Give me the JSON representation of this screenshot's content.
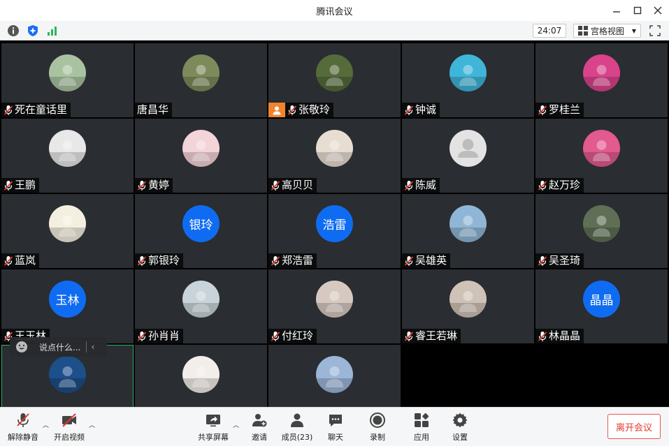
{
  "window": {
    "title": "腾讯会议"
  },
  "infobar": {
    "timer": "24:07",
    "view_label": "宫格视图"
  },
  "participants": [
    {
      "name": "死在童话里",
      "muted": true,
      "avatar": "photo",
      "color": "#a9c3a0"
    },
    {
      "name": "唐昌华",
      "muted": false,
      "avatar": "photo",
      "color": "#7d8a5a"
    },
    {
      "name": "张敬玲",
      "muted": true,
      "avatar": "photo",
      "color": "#556b3a",
      "host": true
    },
    {
      "name": "钟诚",
      "muted": true,
      "avatar": "photo",
      "color": "#3fb5d9"
    },
    {
      "name": "罗桂兰",
      "muted": true,
      "avatar": "photo",
      "color": "#d9438a"
    },
    {
      "name": "王鹏",
      "muted": true,
      "avatar": "photo",
      "color": "#e8e8e8"
    },
    {
      "name": "黄婷",
      "muted": true,
      "avatar": "photo",
      "color": "#f3d4d8"
    },
    {
      "name": "高贝贝",
      "muted": true,
      "avatar": "photo",
      "color": "#e8ddd2"
    },
    {
      "name": "陈威",
      "muted": true,
      "avatar": "default",
      "color": "#e0e0e0"
    },
    {
      "name": "赵万珍",
      "muted": true,
      "avatar": "photo",
      "color": "#e25a8f"
    },
    {
      "name": "蓝岚",
      "muted": true,
      "avatar": "photo",
      "color": "#f4f0e0"
    },
    {
      "name": "郭银玲",
      "muted": true,
      "avatar": "text",
      "text": "银玲"
    },
    {
      "name": "郑浩雷",
      "muted": true,
      "avatar": "text",
      "text": "浩雷"
    },
    {
      "name": "吴雄英",
      "muted": true,
      "avatar": "photo",
      "color": "#8fb6d6"
    },
    {
      "name": "吴圣琦",
      "muted": true,
      "avatar": "photo",
      "color": "#5f6f55"
    },
    {
      "name": "王玉林",
      "muted": true,
      "avatar": "text",
      "text": "玉林"
    },
    {
      "name": "孙肖肖",
      "muted": true,
      "avatar": "photo",
      "color": "#c8d4da"
    },
    {
      "name": "付红玲",
      "muted": true,
      "avatar": "photo",
      "color": "#d8c9c0"
    },
    {
      "name": "睿王若琳",
      "muted": true,
      "avatar": "photo",
      "color": "#cfc2b6"
    },
    {
      "name": "林晶晶",
      "muted": true,
      "avatar": "text",
      "text": "晶晶"
    },
    {
      "name": "",
      "muted": true,
      "avatar": "photo",
      "color": "#1d4f8a",
      "active": true
    },
    {
      "name": "",
      "muted": true,
      "avatar": "photo",
      "color": "#f2eeea"
    },
    {
      "name": "",
      "muted": true,
      "avatar": "photo",
      "color": "#9cb6d8"
    }
  ],
  "chat": {
    "placeholder": "说点什么..."
  },
  "toolbar": {
    "unmute": "解除静音",
    "video": "开启视频",
    "share": "共享屏幕",
    "invite": "邀请",
    "members": "成员(23)",
    "chat": "聊天",
    "record": "录制",
    "apps": "应用",
    "settings": "设置",
    "leave": "离开会议"
  },
  "colors": {
    "accent": "#0f6cf2",
    "leave": "#e03b2f",
    "host_badge": "#f1832f"
  }
}
